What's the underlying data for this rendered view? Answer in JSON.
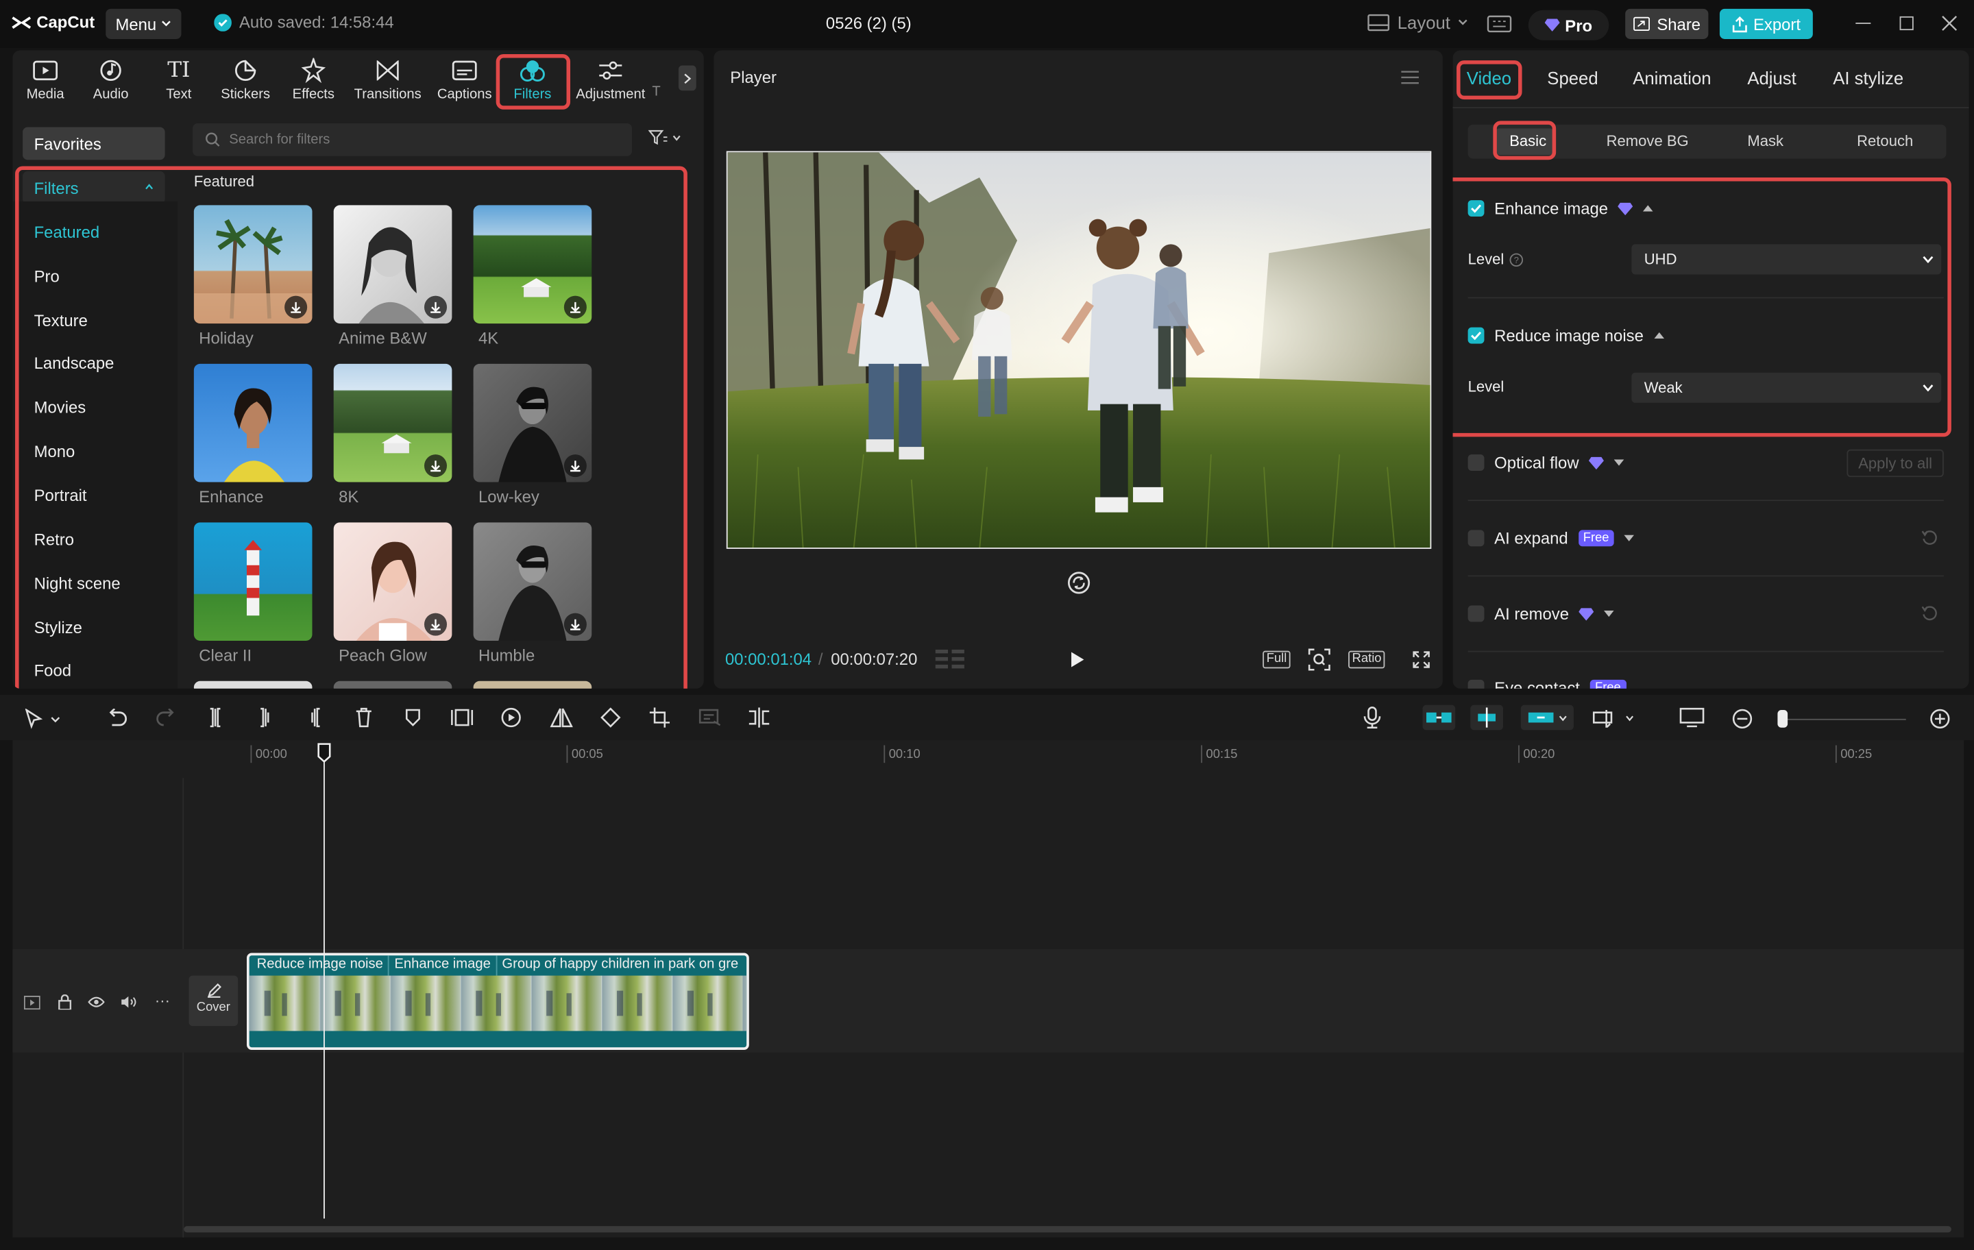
{
  "app": {
    "name": "CapCut",
    "menu_label": "Menu",
    "autosave_text": "Auto saved: 14:58:44",
    "project_title": "0526 (2) (5)",
    "layout_label": "Layout",
    "pro_label": "Pro",
    "share_label": "Share",
    "export_label": "Export"
  },
  "toolbar_tabs": [
    {
      "label": "Media"
    },
    {
      "label": "Audio"
    },
    {
      "label": "Text"
    },
    {
      "label": "Stickers"
    },
    {
      "label": "Effects"
    },
    {
      "label": "Transitions"
    },
    {
      "label": "Captions"
    },
    {
      "label": "Filters"
    },
    {
      "label": "Adjustment"
    },
    {
      "label": "T"
    }
  ],
  "filters_panel": {
    "favorites_label": "Favorites",
    "search_placeholder": "Search for filters",
    "category_header": "Filters",
    "categories": [
      "Featured",
      "Pro",
      "Texture",
      "Landscape",
      "Movies",
      "Mono",
      "Portrait",
      "Retro",
      "Night scene",
      "Stylize",
      "Food"
    ],
    "section_title": "Featured",
    "items": [
      {
        "name": "Holiday"
      },
      {
        "name": "Anime B&W"
      },
      {
        "name": "4K"
      },
      {
        "name": "Enhance"
      },
      {
        "name": "8K"
      },
      {
        "name": "Low-key"
      },
      {
        "name": "Clear II"
      },
      {
        "name": "Peach Glow"
      },
      {
        "name": "Humble"
      }
    ]
  },
  "player": {
    "title": "Player",
    "current_time": "00:00:01:04",
    "total_time": "00:00:07:20",
    "full_label": "Full",
    "ratio_label": "Ratio"
  },
  "inspector": {
    "tabs": [
      "Video",
      "Speed",
      "Animation",
      "Adjust",
      "AI stylize"
    ],
    "subtabs": [
      "Basic",
      "Remove BG",
      "Mask",
      "Retouch"
    ],
    "enhance_image": {
      "label": "Enhance image",
      "level_label": "Level",
      "level_value": "UHD",
      "checked": true
    },
    "reduce_noise": {
      "label": "Reduce image noise",
      "level_label": "Level",
      "level_value": "Weak",
      "checked": true
    },
    "optical_flow": {
      "label": "Optical flow",
      "apply_all": "Apply to all"
    },
    "ai_expand": {
      "label": "AI expand",
      "badge": "Free"
    },
    "ai_remove": {
      "label": "AI remove"
    },
    "eye_contact": {
      "label": "Eye contact",
      "badge": "Free"
    }
  },
  "timeline": {
    "ruler": [
      "00:00",
      "00:05",
      "00:10",
      "00:15",
      "00:20",
      "00:25"
    ],
    "cover_label": "Cover",
    "clip_labels": [
      "Reduce image noise",
      "Enhance image",
      "Group of happy children in park on gre"
    ]
  },
  "colors": {
    "accent": "#1ab8c8",
    "highlight_box": "#e04848",
    "pro_gem": "#8a7bff"
  }
}
